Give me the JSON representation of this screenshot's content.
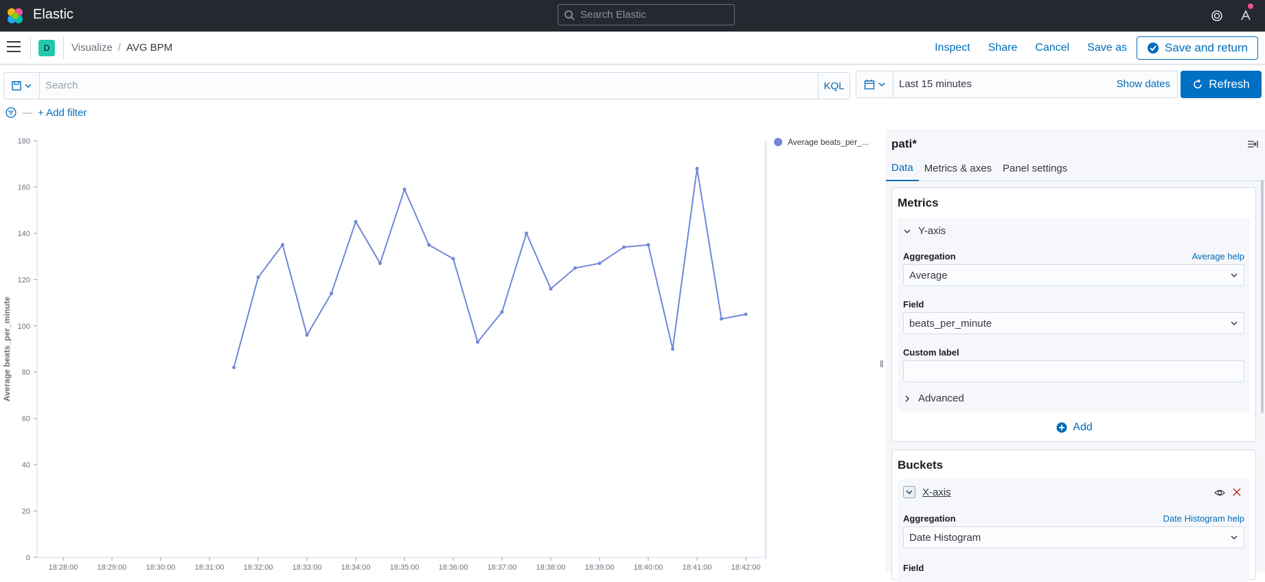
{
  "app": {
    "brand": "Elastic",
    "search_placeholder": "Search Elastic"
  },
  "nav": {
    "space_initial": "D",
    "breadcrumb": {
      "parent": "Visualize",
      "separator": "/",
      "current": "AVG BPM"
    },
    "actions": {
      "inspect": "Inspect",
      "share": "Share",
      "cancel": "Cancel",
      "save_as": "Save as",
      "save_return": "Save and return"
    }
  },
  "query": {
    "placeholder": "Search",
    "language": "KQL"
  },
  "time": {
    "range": "Last 15 minutes",
    "show_dates": "Show dates",
    "refresh": "Refresh"
  },
  "filters": {
    "add_filter": "+ Add filter"
  },
  "chart_data": {
    "type": "line",
    "ylabel": "Average beats_per_minute",
    "xlabel": "",
    "ylim": [
      0,
      180
    ],
    "yticks": [
      "0",
      "20",
      "40",
      "60",
      "80",
      "100",
      "120",
      "140",
      "160",
      "180"
    ],
    "xticks": [
      "18:28:00",
      "18:29:00",
      "18:30:00",
      "18:31:00",
      "18:32:00",
      "18:33:00",
      "18:34:00",
      "18:35:00",
      "18:36:00",
      "18:37:00",
      "18:38:00",
      "18:39:00",
      "18:40:00",
      "18:41:00",
      "18:42:00"
    ],
    "legend_position": "top-right",
    "series": [
      {
        "name": "Average beats_per_...",
        "color": "#6f87d8",
        "x": [
          "18:31:30",
          "18:32:00",
          "18:32:30",
          "18:33:00",
          "18:33:30",
          "18:34:00",
          "18:34:30",
          "18:35:00",
          "18:35:30",
          "18:36:00",
          "18:36:30",
          "18:37:00",
          "18:37:30",
          "18:38:00",
          "18:38:30",
          "18:39:00",
          "18:39:30",
          "18:40:00",
          "18:40:30",
          "18:41:00",
          "18:41:30",
          "18:42:00"
        ],
        "values": [
          82,
          121,
          135,
          96,
          114,
          145,
          127,
          159,
          135,
          129,
          93,
          106,
          140,
          116,
          125,
          127,
          134,
          135,
          90,
          168,
          103,
          105
        ]
      }
    ]
  },
  "sidebar": {
    "index": "pati*",
    "tabs": [
      "Data",
      "Metrics & axes",
      "Panel settings"
    ],
    "metrics": {
      "title": "Metrics",
      "agg_title": "Y-axis",
      "aggregation_label": "Aggregation",
      "aggregation_help": "Average help",
      "aggregation_value": "Average",
      "field_label": "Field",
      "field_value": "beats_per_minute",
      "custom_label": "Custom label",
      "custom_label_value": "",
      "advanced": "Advanced",
      "add": "Add"
    },
    "buckets": {
      "title": "Buckets",
      "agg_title": "X-axis",
      "aggregation_label": "Aggregation",
      "aggregation_help": "Date Histogram help",
      "aggregation_value": "Date Histogram",
      "field_label": "Field"
    }
  }
}
